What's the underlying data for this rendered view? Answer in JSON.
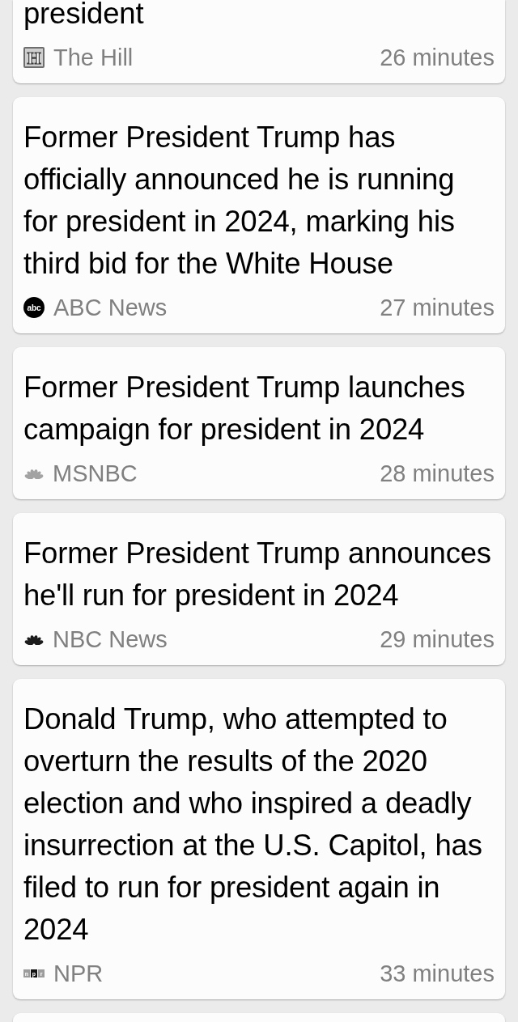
{
  "articles": [
    {
      "headline": "president",
      "source": {
        "name": "The Hill",
        "logo": {
          "kind": "block",
          "text": "H"
        }
      },
      "time": "26 minutes"
    },
    {
      "headline": "Former President Trump has officially announced he is running for president in 2024, marking his third bid for the White House",
      "source": {
        "name": "ABC News",
        "logo": {
          "kind": "disc",
          "text": "abc"
        }
      },
      "time": "27 minutes"
    },
    {
      "headline": "Former President Trump launches campaign for president in 2024",
      "source": {
        "name": "MSNBC",
        "logo": {
          "kind": "fan",
          "color": "#a3a3a3"
        }
      },
      "time": "28 minutes"
    },
    {
      "headline": "Former President Trump announces he'll run for president in 2024",
      "source": {
        "name": "NBC News",
        "logo": {
          "kind": "fan",
          "color": "#1c1c1c"
        }
      },
      "time": "29 minutes"
    },
    {
      "headline": "Donald Trump, who attempted to overturn the results of the 2020 election and who inspired a deadly insurrection at the U.S. Capitol, has filed to run for president again in 2024",
      "source": {
        "name": "NPR",
        "logo": {
          "kind": "tiles",
          "text": "npr"
        }
      },
      "time": "33 minutes"
    }
  ]
}
